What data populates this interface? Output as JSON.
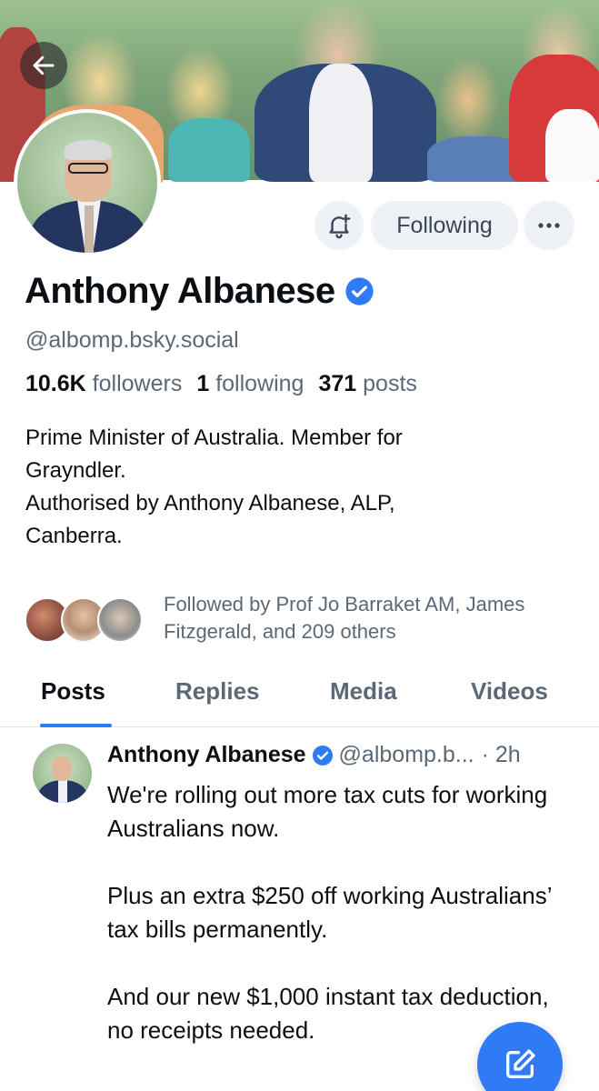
{
  "profile": {
    "display_name": "Anthony Albanese",
    "handle": "@albomp.bsky.social",
    "followers_count": "10.6K",
    "followers_label": "followers",
    "following_count": "1",
    "following_label": "following",
    "posts_count": "371",
    "posts_label": "posts",
    "bio_lines": [
      "Prime Minister of Australia. Member for",
      "Grayndler.",
      "Authorised by Anthony Albanese, ALP,",
      "Canberra."
    ],
    "followed_by": "Followed by Prof Jo Barraket AM, James Fitzgerald, and 209 others"
  },
  "actions": {
    "following_label": "Following",
    "subscribe_icon": "bell-plus-icon",
    "more_icon": "ellipsis-icon",
    "back_icon": "arrow-left-icon"
  },
  "tabs": [
    {
      "label": "Posts",
      "active": true
    },
    {
      "label": "Replies",
      "active": false
    },
    {
      "label": "Media",
      "active": false
    },
    {
      "label": "Videos",
      "active": false
    }
  ],
  "post": {
    "author": "Anthony Albanese",
    "handle": "@albomp.b...",
    "time": "· 2h",
    "paragraphs": [
      "We're rolling out more tax cuts for working Australians now.",
      "Plus an extra $250 off working Australians’ tax bills permanently.",
      "And our new $1,000 instant tax deduction, no receipts needed."
    ]
  },
  "colors": {
    "accent": "#2f7bf5",
    "muted_text": "#5b6876",
    "button_bg": "#eef1f5"
  }
}
